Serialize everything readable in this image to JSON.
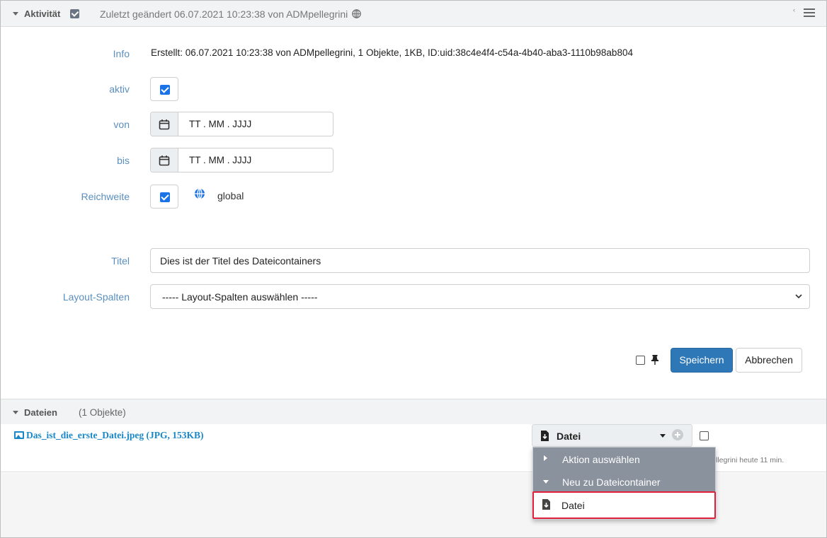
{
  "header": {
    "title": "Aktivität",
    "changed": "Zuletzt geändert 06.07.2021 10:23:38 von ADMpellegrini",
    "collapse_arrow": "‹"
  },
  "form": {
    "info_label": "Info",
    "info_text": "Erstellt: 06.07.2021 10:23:38 von ADMpellegrini, 1 Objekte, 1KB, ID:uid:38c4e4f4-c54a-4b40-aba3-1110b98ab804",
    "aktiv_label": "aktiv",
    "von_label": "von",
    "von_value": "TT . MM . JJJJ",
    "bis_label": "bis",
    "bis_value": "TT . MM . JJJJ",
    "reichweite_label": "Reichweite",
    "reichweite_value": "global",
    "titel_label": "Titel",
    "titel_value": "Dies ist der Titel des Dateicontainers",
    "layout_label": "Layout-Spalten",
    "layout_value": "----- Layout-Spalten auswählen -----",
    "save_label": "Speichern",
    "cancel_label": "Abbrechen"
  },
  "files": {
    "section_title": "Dateien",
    "count": "(1 Objekte)",
    "file_name": "Das_ist_die_erste_Datei.jpeg (JPG, 153KB)",
    "type_button": "Datei",
    "meta": "llegrini heute 11 min."
  },
  "menu": {
    "action": "Aktion auswählen",
    "new_to_container": "Neu zu Dateicontainer",
    "file_item": "Datei"
  },
  "colors": {
    "accent": "#2f78b7",
    "label": "#5a8fbe",
    "highlight": "#e0203a",
    "menu_dark": "#8a929d"
  }
}
